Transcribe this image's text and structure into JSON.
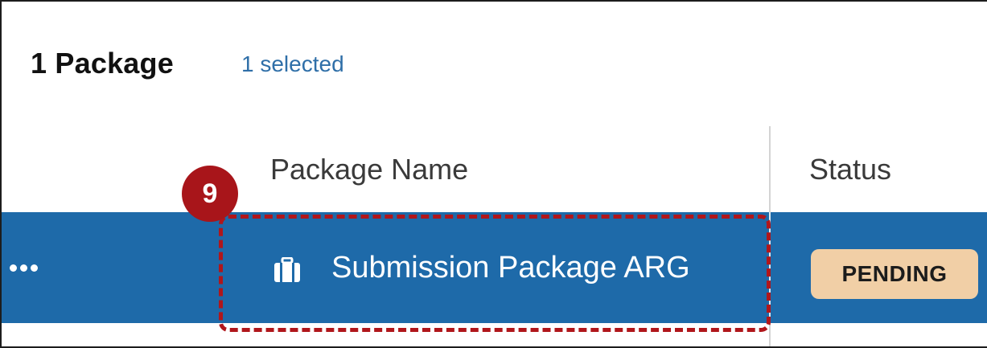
{
  "header": {
    "package_count": "1 Package",
    "selected_count": "1 selected"
  },
  "columns": {
    "package_name": "Package Name",
    "status": "Status"
  },
  "rows": [
    {
      "menu_icon": "more-horizontal-icon",
      "package_icon": "briefcase-icon",
      "name": "Submission Package ARG",
      "status": "PENDING"
    }
  ],
  "annotation": {
    "step_number": "9"
  },
  "colors": {
    "selected_row": "#1e6aa9",
    "pending_badge": "#f1cfa6",
    "annotation_red": "#a8151a",
    "selected_text": "#2f6fa8"
  }
}
